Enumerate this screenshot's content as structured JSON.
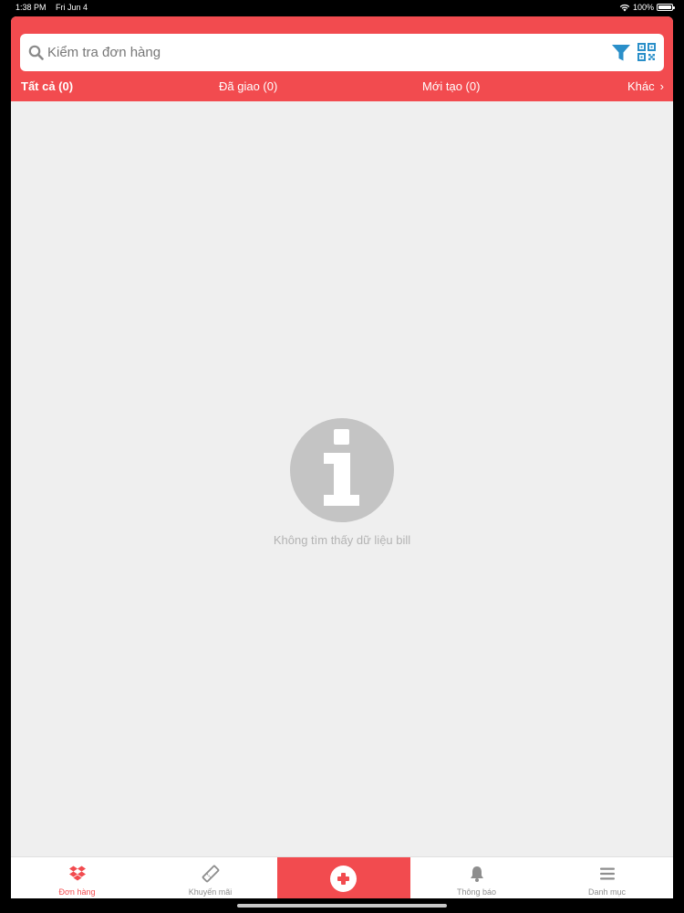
{
  "status_bar": {
    "time": "1:38 PM",
    "date": "Fri Jun 4",
    "battery": "100%"
  },
  "search": {
    "placeholder": "Kiểm tra đơn hàng",
    "value": ""
  },
  "tabs": [
    {
      "label": "Tất cả (0)"
    },
    {
      "label": "Đã giao (0)"
    },
    {
      "label": "Mới tạo (0)"
    },
    {
      "label": "Khác"
    }
  ],
  "empty_state": {
    "message": "Không tìm thấy dữ liệu bill"
  },
  "bottom_nav": {
    "items": [
      {
        "label": "Đơn hàng",
        "icon": "dropbox-icon"
      },
      {
        "label": "Khuyến mãi",
        "icon": "ticket-icon"
      },
      {
        "label": "",
        "icon": "plus-icon"
      },
      {
        "label": "Thông báo",
        "icon": "bell-icon"
      },
      {
        "label": "Danh mục",
        "icon": "menu-icon"
      }
    ]
  },
  "colors": {
    "brand": "#f24b4f",
    "accent_blue": "#2a8fc9",
    "background": "#efefef"
  }
}
